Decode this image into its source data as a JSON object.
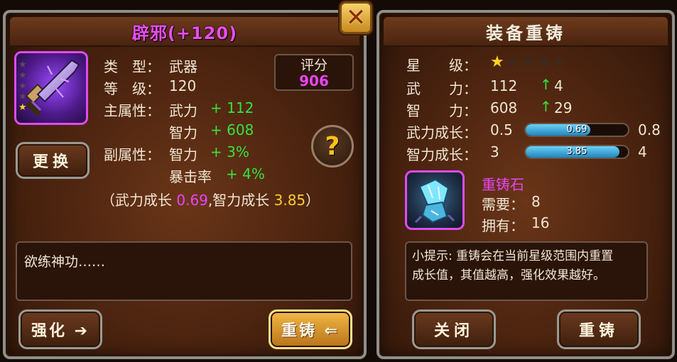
{
  "close_label": "✕",
  "left": {
    "title": "辟邪(+120)",
    "item_stars": {
      "total": 5,
      "filled": 1
    },
    "type_label": "类　型：",
    "type_value": "武器",
    "level_label": "等　级：",
    "level_value": "120",
    "main_attr_label": "副属性：",
    "primary_label": "主属性：",
    "primary_attrs": [
      {
        "name": "武力",
        "value": "+ 112"
      },
      {
        "name": "智力",
        "value": "+ 608"
      }
    ],
    "secondary_label": "副属性：",
    "secondary_attrs": [
      {
        "name": "智力",
        "value": "+ 3%"
      },
      {
        "name": "暴击率",
        "value": "+ 4%"
      }
    ],
    "growth_prefix": "（武力成长 ",
    "growth_wu": "0.69",
    "growth_mid": ",智力成长 ",
    "growth_zhi": "3.85",
    "growth_suffix": "）",
    "score_label": "评分",
    "score_value": "906",
    "help_symbol": "?",
    "replace_button": "更换",
    "description": "欲练神功……",
    "strengthen_button": "强化 ➔",
    "recast_button": "重铸 ⇐"
  },
  "right": {
    "title": "装备重铸",
    "star_label": "星　　级：",
    "stars": {
      "total": 5,
      "filled": 1
    },
    "wu_label": "武　　力：",
    "wu_value": "112",
    "wu_change": "4",
    "zhi_label": "智　　力：",
    "zhi_value": "608",
    "zhi_change": "29",
    "up_arrow": "↑",
    "wu_growth_label": "武力成长：",
    "wu_growth_min": "0.5",
    "wu_growth_current": "0.69",
    "wu_growth_max": "0.8",
    "wu_growth_fraction": 0.63,
    "zhi_growth_label": "智力成长：",
    "zhi_growth_min": "3",
    "zhi_growth_current": "3.85",
    "zhi_growth_max": "4",
    "zhi_growth_fraction": 0.92,
    "material_name": "重铸石",
    "need_label": "需要：",
    "need_value": "8",
    "own_label": "拥有：",
    "own_value": "16",
    "tip_line1": "小提示: 重铸会在当前星级范围内重置",
    "tip_line2": "成长值，其值越高，强化效果越好。",
    "close_button": "关闭",
    "recast_button": "重铸"
  },
  "colors": {
    "magenta": "#e845f0",
    "green": "#37e23c",
    "gold": "#ffcc33",
    "bar_blue": "#1f86bf"
  }
}
